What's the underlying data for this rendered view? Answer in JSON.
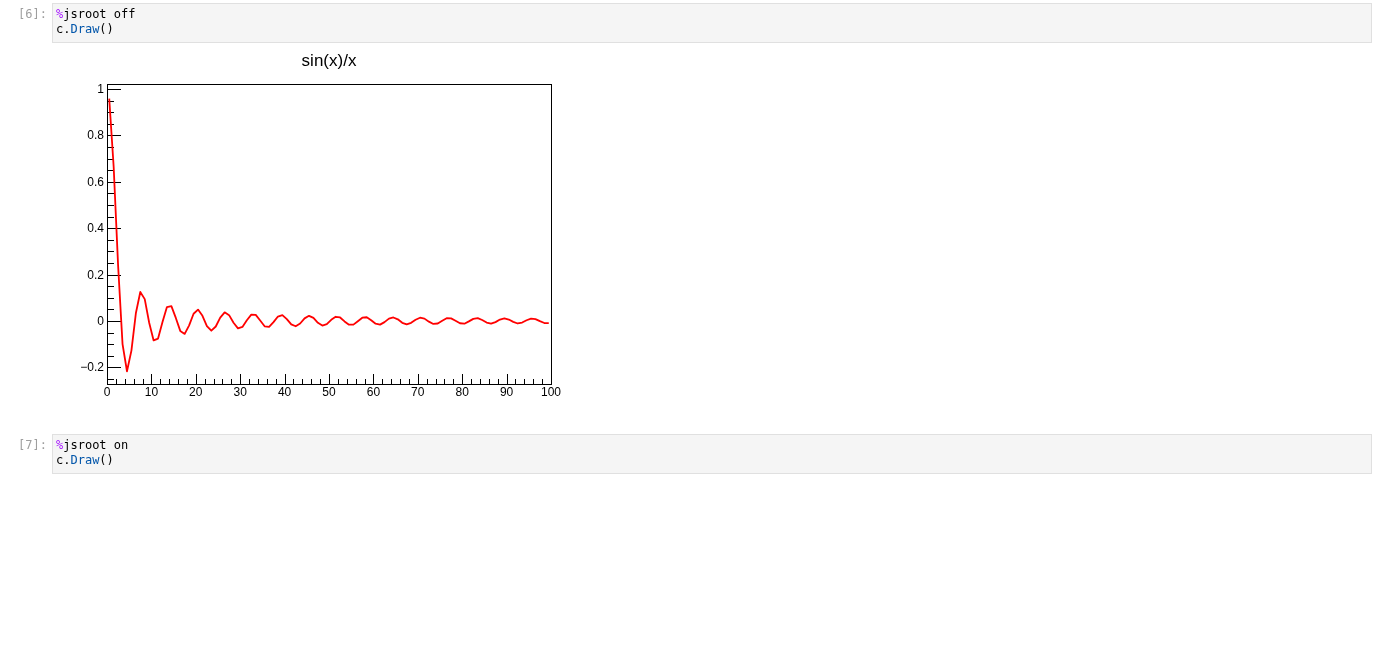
{
  "cells": [
    {
      "prompt": "[6]:",
      "code": [
        [
          {
            "kind": "magic",
            "text": "%"
          },
          {
            "kind": "plain",
            "text": "jsroot off"
          }
        ],
        [
          {
            "kind": "plain",
            "text": "c."
          },
          {
            "kind": "property",
            "text": "Draw"
          },
          {
            "kind": "plain",
            "text": "()"
          }
        ]
      ],
      "output": {
        "chart_data": {
          "type": "line",
          "title": "sin(x)/x",
          "xlim": [
            0,
            100
          ],
          "ylim": [
            -0.272,
            1.022
          ],
          "xticks": [
            0,
            10,
            20,
            30,
            40,
            50,
            60,
            70,
            80,
            90,
            100
          ],
          "yticks": [
            {
              "value": -0.2,
              "label": "−0.2"
            },
            0,
            0.2,
            0.4,
            0.6,
            0.8,
            1
          ],
          "x": [
            0.5,
            1.5,
            2.5,
            3.5,
            4.5,
            5.5,
            6.5,
            7.5,
            8.5,
            9.5,
            10.5,
            11.5,
            12.5,
            13.5,
            14.5,
            15.5,
            16.5,
            17.5,
            18.5,
            19.5,
            20.5,
            21.5,
            22.5,
            23.5,
            24.5,
            25.5,
            26.5,
            27.5,
            28.5,
            29.5,
            30.5,
            31.5,
            32.5,
            33.5,
            34.5,
            35.5,
            36.5,
            37.5,
            38.5,
            39.5,
            40.5,
            41.5,
            42.5,
            43.5,
            44.5,
            45.5,
            46.5,
            47.5,
            48.5,
            49.5,
            50.5,
            51.5,
            52.5,
            53.5,
            54.5,
            55.5,
            56.5,
            57.5,
            58.5,
            59.5,
            60.5,
            61.5,
            62.5,
            63.5,
            64.5,
            65.5,
            66.5,
            67.5,
            68.5,
            69.5,
            70.5,
            71.5,
            72.5,
            73.5,
            74.5,
            75.5,
            76.5,
            77.5,
            78.5,
            79.5,
            80.5,
            81.5,
            82.5,
            83.5,
            84.5,
            85.5,
            86.5,
            87.5,
            88.5,
            89.5,
            90.5,
            91.5,
            92.5,
            93.5,
            94.5,
            95.5,
            96.5,
            97.5,
            98.5,
            99.5
          ],
          "values": [
            0.959,
            0.665,
            0.239,
            -0.1,
            -0.217,
            -0.128,
            0.033,
            0.125,
            0.094,
            -0.008,
            -0.084,
            -0.076,
            -0.005,
            0.06,
            0.064,
            0.013,
            -0.043,
            -0.056,
            -0.019,
            0.031,
            0.049,
            0.022,
            -0.022,
            -0.042,
            -0.024,
            0.014,
            0.037,
            0.025,
            -0.008,
            -0.032,
            -0.026,
            0.003,
            0.027,
            0.026,
            0.002,
            -0.023,
            -0.026,
            -0.005,
            0.019,
            0.025,
            0.008,
            -0.015,
            -0.023,
            -0.011,
            0.011,
            0.022,
            0.013,
            -0.008,
            -0.02,
            -0.014,
            0.005,
            0.018,
            0.015,
            -0.002,
            -0.016,
            -0.016,
            -0.001,
            0.014,
            0.016,
            0.003,
            -0.012,
            -0.016,
            -0.005,
            0.01,
            0.015,
            0.007,
            -0.008,
            -0.015,
            -0.008,
            0.005,
            0.014,
            0.01,
            -0.003,
            -0.013,
            -0.011,
            0.001,
            0.012,
            0.011,
            0.001,
            -0.01,
            -0.012,
            -0.002,
            0.009,
            0.012,
            0.004,
            -0.007,
            -0.012,
            -0.005,
            0.006,
            0.011,
            0.006,
            -0.004,
            -0.011,
            -0.007,
            0.003,
            0.01,
            0.008,
            -0.001,
            -0.009,
            -0.009
          ]
        }
      }
    },
    {
      "prompt": "[7]:",
      "code": [
        [
          {
            "kind": "magic",
            "text": "%"
          },
          {
            "kind": "plain",
            "text": "jsroot on"
          }
        ],
        [
          {
            "kind": "plain",
            "text": "c."
          },
          {
            "kind": "property",
            "text": "Draw"
          },
          {
            "kind": "plain",
            "text": "()"
          }
        ]
      ]
    }
  ]
}
